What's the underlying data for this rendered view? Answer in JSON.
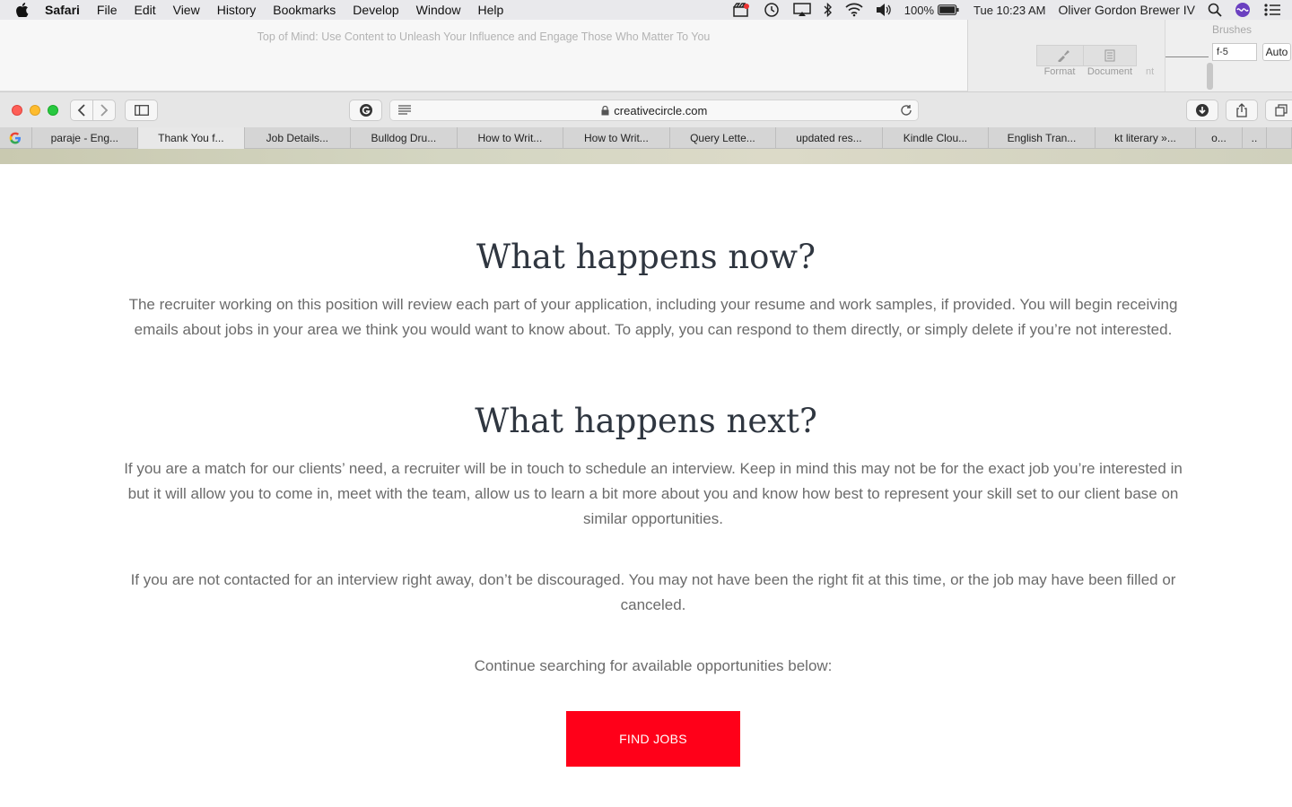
{
  "menubar": {
    "app": "Safari",
    "items": [
      "File",
      "Edit",
      "View",
      "History",
      "Bookmarks",
      "Develop",
      "Window",
      "Help"
    ],
    "battery": "100%",
    "clock": "Tue 10:23 AM",
    "user": "Oliver Gordon Brewer IV"
  },
  "background_window": {
    "doc_title": "Top of Mind: Use Content to Unleash Your Influence and Engage Those Who Matter To You",
    "format_label": "Format",
    "document_label": "Document",
    "edge_label": "nt",
    "brushes_label": "Brushes",
    "stepper_value": "f-5",
    "auto_label": "Auto"
  },
  "browser": {
    "url": "creativecircle.com",
    "tabs": [
      {
        "label": "paraje - Eng...",
        "active": false
      },
      {
        "label": "Thank You f...",
        "active": true
      },
      {
        "label": "Job Details...",
        "active": false
      },
      {
        "label": "Bulldog Dru...",
        "active": false
      },
      {
        "label": "How to Writ...",
        "active": false
      },
      {
        "label": "How to Writ...",
        "active": false
      },
      {
        "label": "Query Lette...",
        "active": false
      },
      {
        "label": "updated res...",
        "active": false
      },
      {
        "label": "Kindle Clou...",
        "active": false
      },
      {
        "label": "English Tran...",
        "active": false
      },
      {
        "label": "kt literary »...",
        "active": false
      },
      {
        "label": "o...",
        "active": false
      },
      {
        "label": "..",
        "active": false
      }
    ]
  },
  "page": {
    "heading_now": "What happens now?",
    "para_now": "The recruiter working on this position will review each part of your application, including your resume and work samples, if provided. You will begin receiving emails about jobs in your area we think you would want to know about. To apply, you can respond to them directly, or simply delete if you’re not interested.",
    "heading_next": "What happens next?",
    "para_next": "If you are a match for our clients’ need, a recruiter will be in touch to schedule an interview. Keep in mind this may not be for the exact job you’re interested in but it will allow you to come in, meet with the team, allow us to learn a bit more about you and know how best to represent your skill set to our client base on similar opportunities.",
    "para_not_contacted": "If you are not contacted for an interview right away, don’t be discouraged. You may not have been the right fit at this time, or the job may have been filled or canceled.",
    "continue_text": "Continue searching for available opportunities below:",
    "find_jobs_label": "FIND JOBS"
  },
  "colors": {
    "accent_button": "#ff0019",
    "heading": "#2f3640",
    "body_text": "#6b6b6b"
  }
}
